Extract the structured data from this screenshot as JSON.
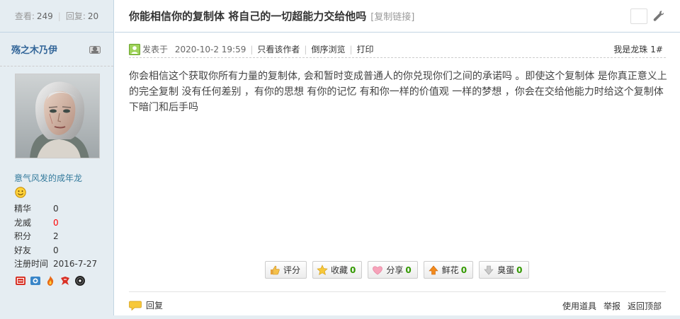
{
  "stats": {
    "views_label": "查看:",
    "views": "249",
    "replies_label": "回复:",
    "replies": "20"
  },
  "author": {
    "name": "殇之木乃伊",
    "group": "意气风发的成年龙"
  },
  "profile": [
    {
      "key": "精华",
      "value": "0"
    },
    {
      "key": "龙威",
      "value": "0"
    },
    {
      "key": "积分",
      "value": "2"
    },
    {
      "key": "好友",
      "value": "0"
    },
    {
      "key": "注册时间",
      "value": "2016-7-27"
    }
  ],
  "thread": {
    "title": "你能相信你的复制体 将自己的一切超能力交给他吗",
    "copy_link": "[复制链接]"
  },
  "post": {
    "posted_prefix": "发表于",
    "time": "2020-10-2 19:59",
    "only_author": "只看该作者",
    "reverse": "倒序浏览",
    "print": "打印",
    "floor_label": "我是龙珠",
    "floor_num": "1#",
    "body": "你会相信这个获取你所有力量的复制体, 会和暂时变成普通人的你兑现你们之间的承诺吗 。即使这个复制体 是你真正意义上的完全复制 没有任何差别 ，有你的思想 有你的记忆 有和你一样的价值观 一样的梦想 ，你会在交给他能力时给这个复制体下暗门和后手吗"
  },
  "actions": [
    {
      "label": "评分",
      "count": ""
    },
    {
      "label": "收藏",
      "count": "0"
    },
    {
      "label": "分享",
      "count": "0"
    },
    {
      "label": "鲜花",
      "count": "0"
    },
    {
      "label": "臭蛋",
      "count": "0"
    }
  ],
  "footer": {
    "reply": "回复",
    "use_item": "使用道具",
    "report": "举报",
    "back_top": "返回顶部"
  },
  "colors": {
    "sidebar_bg": "#e5edf2",
    "border": "#c2d5e3",
    "author_blue": "#336699",
    "count_green": "#339900",
    "highlight_red": "#ff0000"
  },
  "icons": [
    "profile-card-icon",
    "smiley-badge-icon",
    "medal-icons",
    "post-avatar-icon",
    "thumbs-up-icon",
    "star-icon",
    "heart-icon",
    "arrow-up-icon",
    "arrow-down-icon",
    "reply-bubble-icon",
    "wrench-icon"
  ]
}
